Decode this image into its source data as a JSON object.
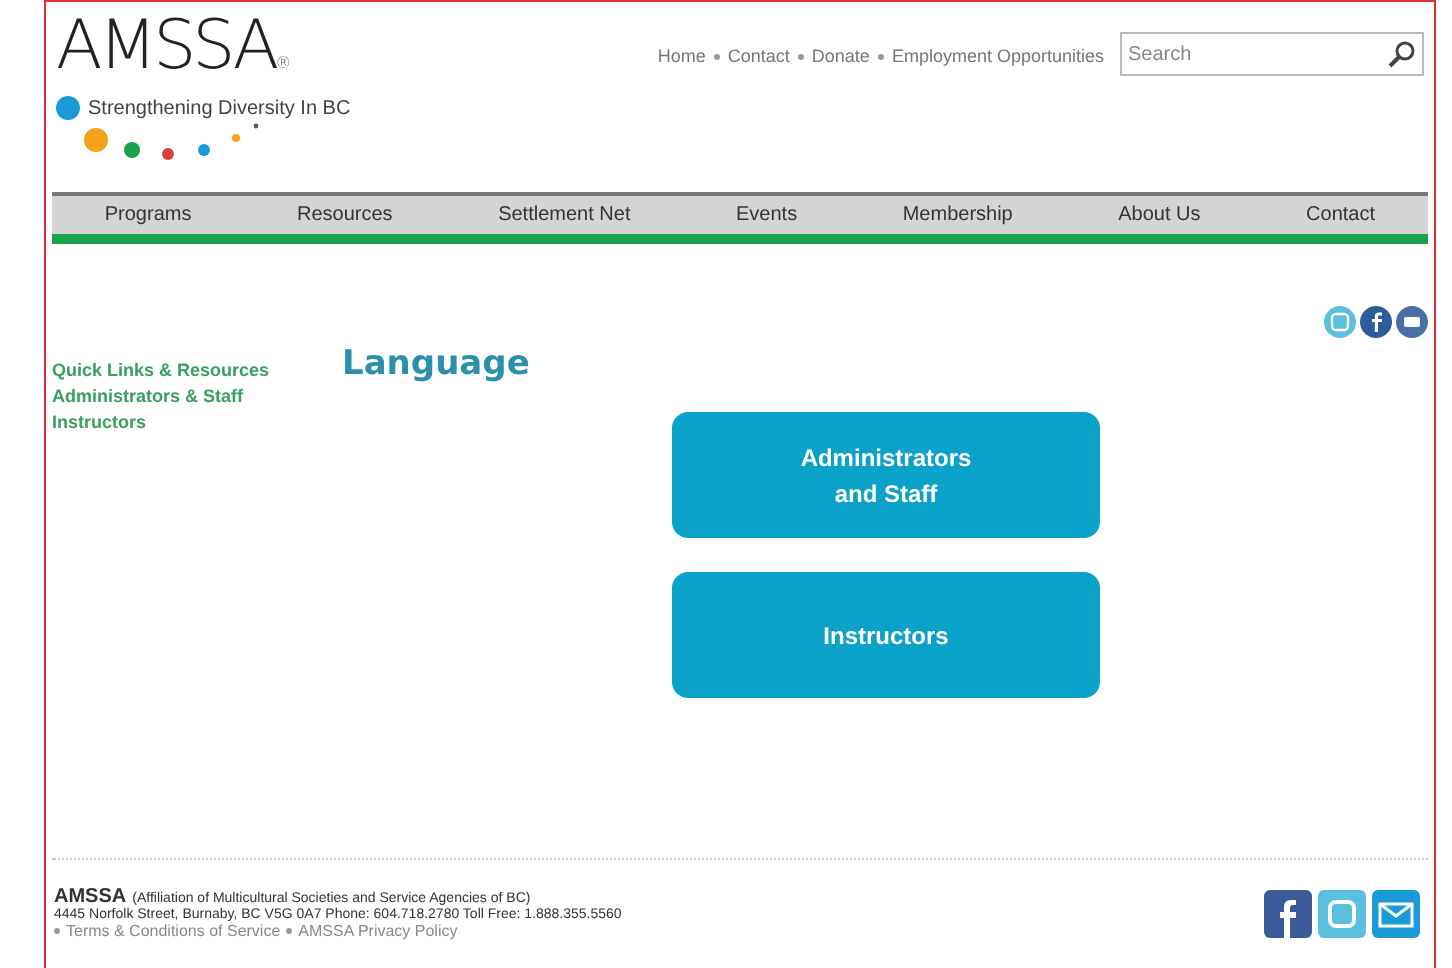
{
  "logo": {
    "name": "AMSSA",
    "registered": "®",
    "tagline": "Strengthening Diversity In BC"
  },
  "top_links": [
    "Home",
    "Contact",
    "Donate",
    "Employment Opportunities"
  ],
  "search": {
    "placeholder": "Search"
  },
  "nav": [
    "Programs",
    "Resources",
    "Settlement Net",
    "Events",
    "Membership",
    "About Us",
    "Contact"
  ],
  "sidebar": {
    "items": [
      "Quick Links & Resources",
      "Administrators & Staff",
      "Instructors"
    ]
  },
  "heading": "Language",
  "buttons": [
    "Administrators\nand Staff",
    "Instructors"
  ],
  "footer": {
    "name": "AMSSA",
    "full_name": "(Affiliation of Multicultural Societies and Service Agencies of BC)",
    "address": "4445 Norfolk Street, Burnaby, BC V5G 0A7 Phone: 604.718.2780 Toll Free: 1.888.355.5560",
    "links": [
      "Terms & Conditions of Service",
      "AMSSA Privacy Policy"
    ]
  }
}
